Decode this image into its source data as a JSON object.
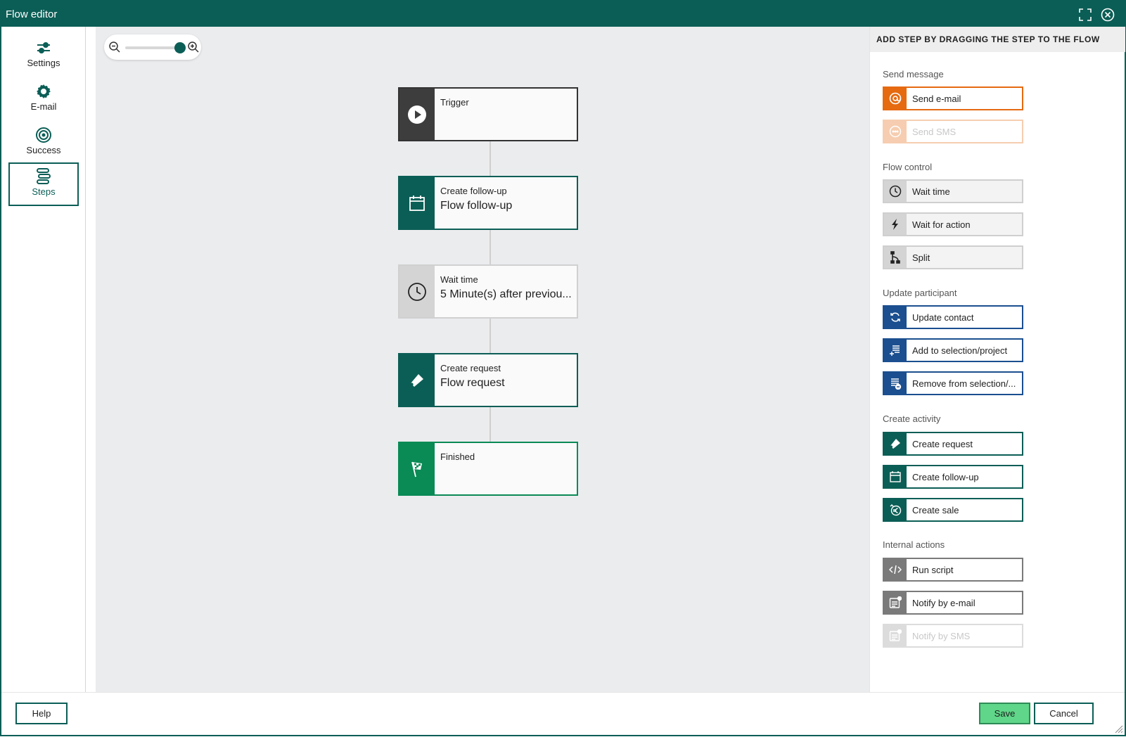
{
  "window": {
    "title": "Flow editor"
  },
  "nav": {
    "items": [
      {
        "label": "Settings",
        "icon": "sliders-icon",
        "active": false
      },
      {
        "label": "E-mail",
        "icon": "gear-icon",
        "active": false
      },
      {
        "label": "Success",
        "icon": "target-icon",
        "active": false
      },
      {
        "label": "Steps",
        "icon": "steps-icon",
        "active": true
      }
    ]
  },
  "zoom": {
    "level": 1.0
  },
  "flow": {
    "nodes": [
      {
        "type": "Trigger",
        "detail": "",
        "icon": "play-icon"
      },
      {
        "type": "Create follow-up",
        "detail": "Flow follow-up",
        "icon": "calendar-icon"
      },
      {
        "type": "Wait time",
        "detail": "5 Minute(s) after previou...",
        "icon": "clock-icon"
      },
      {
        "type": "Create request",
        "detail": "Flow request",
        "icon": "ticket-icon"
      },
      {
        "type": "Finished",
        "detail": "",
        "icon": "checkered-flag-icon"
      }
    ]
  },
  "palette": {
    "header": "ADD STEP BY DRAGGING THE STEP TO THE FLOW",
    "sections": [
      {
        "label": "Send message",
        "steps": [
          {
            "label": "Send e-mail",
            "icon": "at-icon",
            "enabled": true
          },
          {
            "label": "Send SMS",
            "icon": "chat-icon",
            "enabled": false
          }
        ]
      },
      {
        "label": "Flow control",
        "steps": [
          {
            "label": "Wait time",
            "icon": "clock-icon",
            "enabled": true
          },
          {
            "label": "Wait for action",
            "icon": "lightning-icon",
            "enabled": true
          },
          {
            "label": "Split",
            "icon": "split-icon",
            "enabled": true
          }
        ]
      },
      {
        "label": "Update participant",
        "steps": [
          {
            "label": "Update contact",
            "icon": "refresh-icon",
            "enabled": true
          },
          {
            "label": "Add to selection/project",
            "icon": "list-add-icon",
            "enabled": true
          },
          {
            "label": "Remove from selection/...",
            "icon": "list-remove-icon",
            "enabled": true
          }
        ]
      },
      {
        "label": "Create activity",
        "steps": [
          {
            "label": "Create request",
            "icon": "ticket-icon",
            "enabled": true
          },
          {
            "label": "Create follow-up",
            "icon": "calendar-icon",
            "enabled": true
          },
          {
            "label": "Create sale",
            "icon": "euro-icon",
            "enabled": true
          }
        ]
      },
      {
        "label": "Internal actions",
        "steps": [
          {
            "label": "Run script",
            "icon": "code-icon",
            "enabled": true
          },
          {
            "label": "Notify by e-mail",
            "icon": "notify-email-icon",
            "enabled": true
          },
          {
            "label": "Notify by SMS",
            "icon": "notify-sms-icon",
            "enabled": false
          }
        ]
      }
    ]
  },
  "footer": {
    "help": "Help",
    "save": "Save",
    "cancel": "Cancel"
  },
  "colors": {
    "brand": "#0b5e56",
    "orange": "#e56a10",
    "blue": "#1b4f8f",
    "success": "#0a8a55",
    "save": "#5fd689"
  }
}
